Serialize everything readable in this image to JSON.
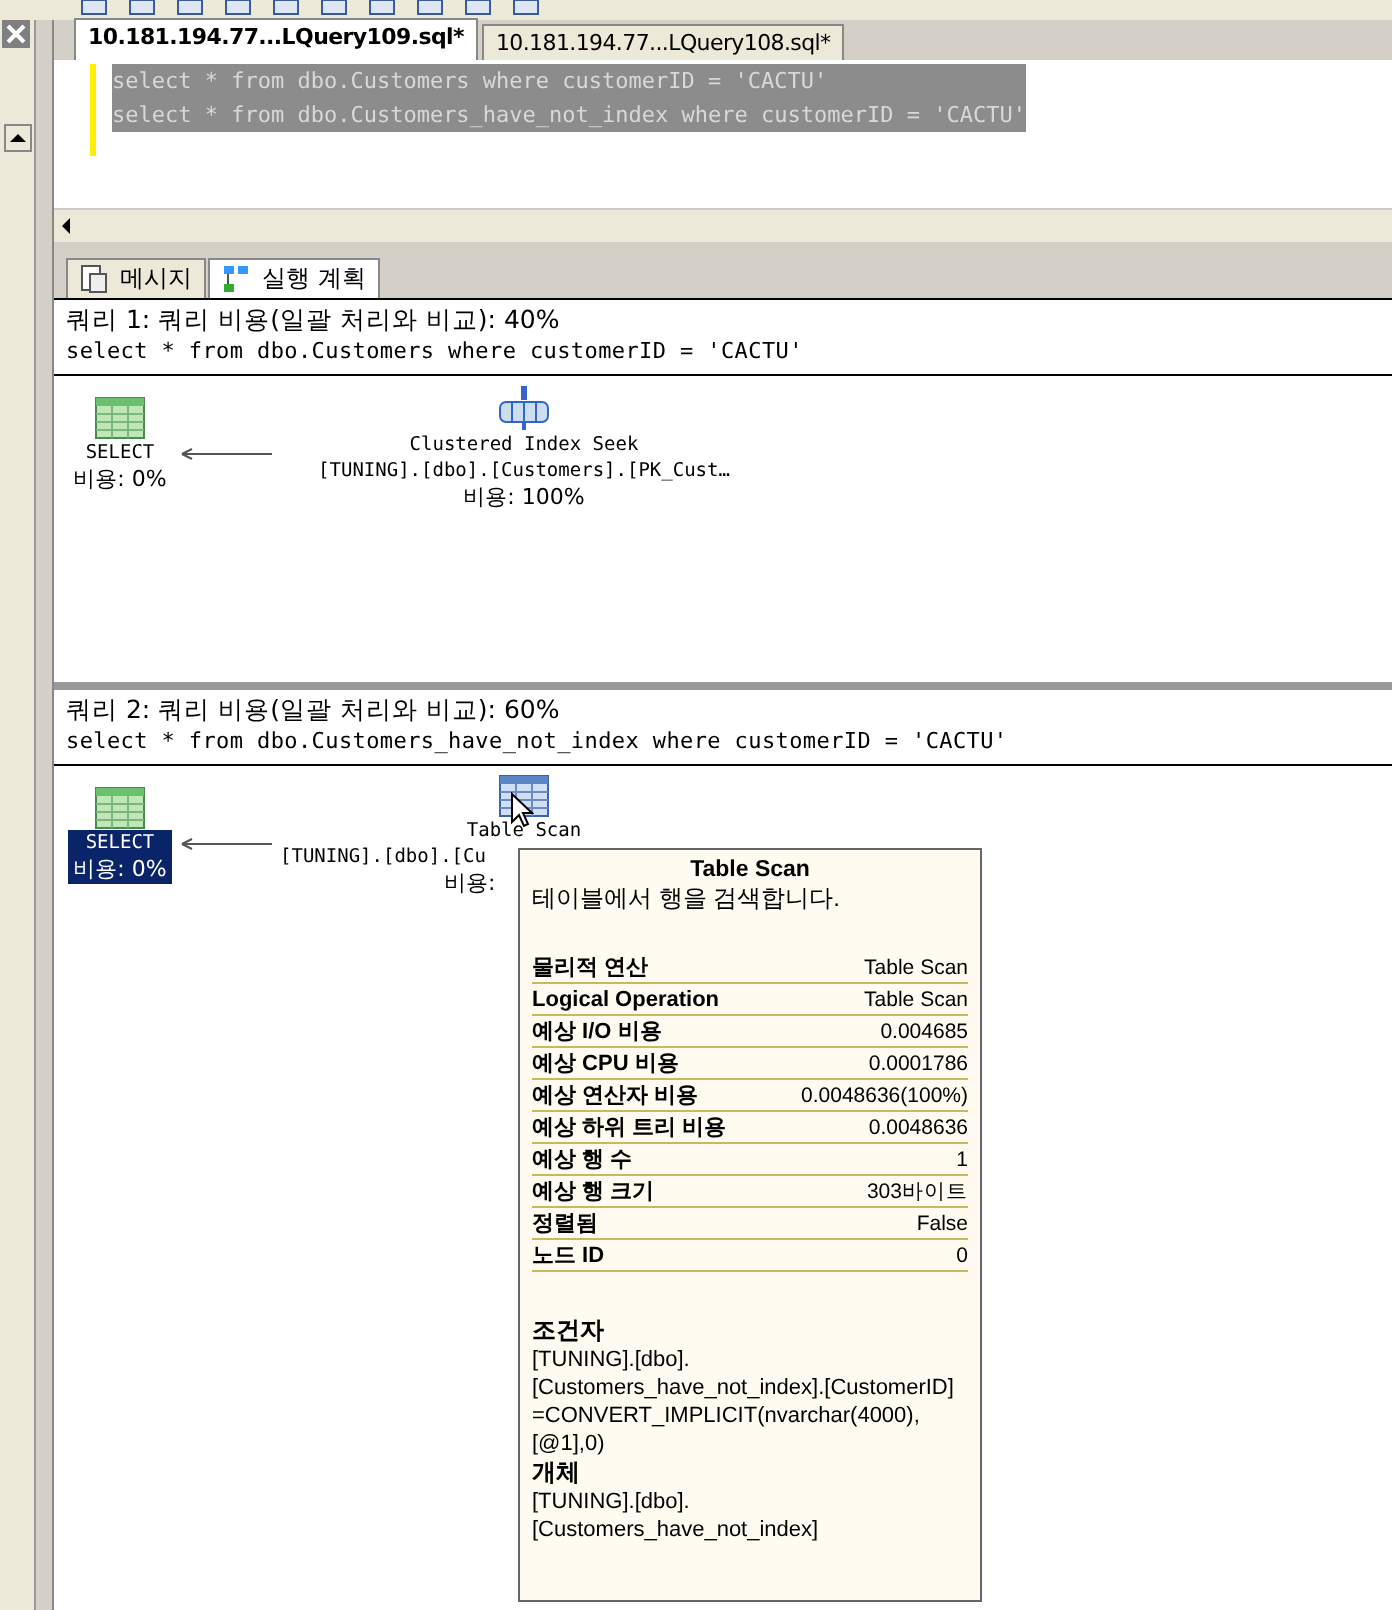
{
  "editor_tabs": [
    {
      "label": "10.181.194.77...LQuery109.sql*",
      "selected": true
    },
    {
      "label": "10.181.194.77...LQuery108.sql*",
      "selected": false
    }
  ],
  "editor_lines": [
    {
      "text": "select * from dbo.Customers where customerID = 'CACTU'",
      "highlighted": true
    },
    {
      "text": "select * from dbo.Customers_have_not_index where customerID = 'CACTU'",
      "highlighted": true
    }
  ],
  "result_tabs": [
    {
      "label": "메시지",
      "kind": "messages",
      "selected": false
    },
    {
      "label": "실행 계획",
      "kind": "plan",
      "selected": true
    }
  ],
  "queries": [
    {
      "header": "쿼리 1: 쿼리 비용(일괄 처리와 비교): 40%",
      "sql": "select * from dbo.Customers where customerID = 'CACTU'",
      "nodes": [
        {
          "kind": "select",
          "label": "SELECT",
          "lines": [
            "비용: 0%"
          ],
          "selected": false
        },
        {
          "kind": "seek",
          "label": "Clustered Index Seek",
          "lines": [
            "[TUNING].[dbo].[Customers].[PK_Cust…",
            "비용: 100%"
          ],
          "selected": false
        }
      ]
    },
    {
      "header": "쿼리 2: 쿼리 비용(일괄 처리와 비교): 60%",
      "sql": "select * from dbo.Customers_have_not_index where customerID = 'CACTU'",
      "nodes": [
        {
          "kind": "select",
          "label": "SELECT",
          "lines": [
            "비용: 0%"
          ],
          "selected": true
        },
        {
          "kind": "scan",
          "label": "Table Scan",
          "lines": [
            "[TUNING].[dbo].[Cu",
            "비용:"
          ],
          "selected": false
        }
      ]
    }
  ],
  "tooltip": {
    "title": "Table Scan",
    "description": "테이블에서 행을 검색합니다.",
    "properties": [
      {
        "name": "물리적 연산",
        "value": "Table Scan"
      },
      {
        "name": "Logical Operation",
        "value": "Table Scan"
      },
      {
        "name": "예상 I/O 비용",
        "value": "0.004685"
      },
      {
        "name": "예상 CPU 비용",
        "value": "0.0001786"
      },
      {
        "name": "예상 연산자 비용",
        "value": "0.0048636(100%)"
      },
      {
        "name": "예상 하위 트리 비용",
        "value": "0.0048636"
      },
      {
        "name": "예상 행 수",
        "value": "1"
      },
      {
        "name": "예상 행 크기",
        "value": "303바이트"
      },
      {
        "name": "정렬됨",
        "value": "False"
      },
      {
        "name": "노드 ID",
        "value": "0"
      }
    ],
    "sections": [
      {
        "heading": "조건자",
        "lines": [
          "[TUNING].[dbo].",
          "[Customers_have_not_index].[CustomerID]",
          "=CONVERT_IMPLICIT(nvarchar(4000),",
          "[@1],0)"
        ]
      },
      {
        "heading": "개체",
        "lines": [
          "[TUNING].[dbo].",
          "[Customers_have_not_index]"
        ]
      }
    ]
  }
}
